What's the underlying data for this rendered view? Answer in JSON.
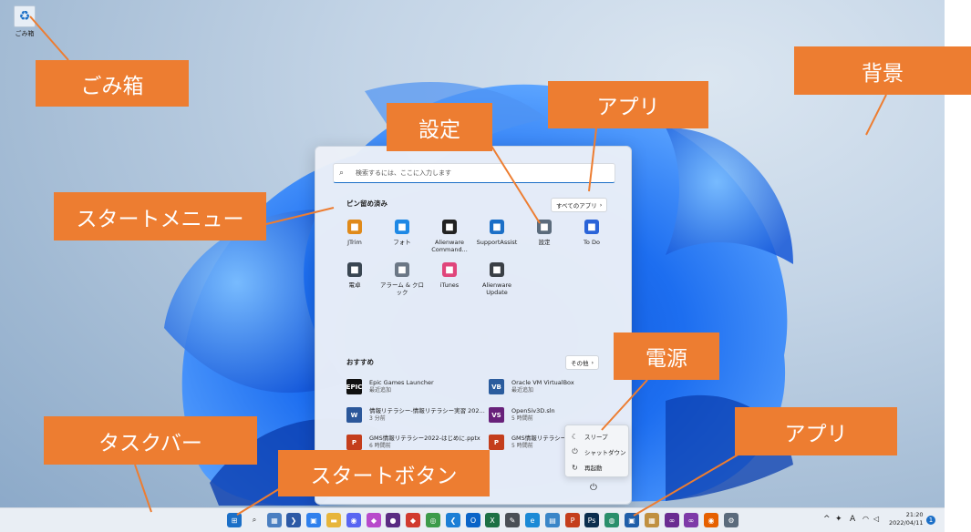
{
  "desktop": {
    "recycle_bin_label": "ごみ箱"
  },
  "callouts": {
    "recycle_bin": "ごみ箱",
    "background": "背景",
    "settings": "設定",
    "apps_top": "アプリ",
    "start_menu": "スタートメニュー",
    "power": "電源",
    "taskbar": "タスクバー",
    "start_button": "スタートボタン",
    "apps_bottom": "アプリ",
    "color": "#ed7d31"
  },
  "start_menu": {
    "search_placeholder": "検索するには、ここに入力します",
    "pinned_title": "ピン留め済み",
    "all_apps_label": "すべてのアプリ",
    "pinned": [
      {
        "label": "JTrim",
        "icon": "jtrim-icon",
        "color": "#e08a1a"
      },
      {
        "label": "フォト",
        "icon": "photos-icon",
        "color": "#1e88e5"
      },
      {
        "label": "Alienware Command...",
        "icon": "alienware-icon",
        "color": "#222222"
      },
      {
        "label": "SupportAssist",
        "icon": "supportassist-icon",
        "color": "#1b6fc7"
      },
      {
        "label": "設定",
        "icon": "gear-icon",
        "color": "#5b6b7c"
      },
      {
        "label": "To Do",
        "icon": "todo-icon",
        "color": "#2a63d8"
      },
      {
        "label": "電卓",
        "icon": "calculator-icon",
        "color": "#3a4652"
      },
      {
        "label": "アラーム & クロック",
        "icon": "clock-icon",
        "color": "#6b7785"
      },
      {
        "label": "iTunes",
        "icon": "itunes-icon",
        "color": "#e0457b"
      },
      {
        "label": "Alienware Update",
        "icon": "alienware-update-icon",
        "color": "#3a3f45"
      }
    ],
    "recommended_title": "おすすめ",
    "more_label": "その他",
    "recommended": [
      {
        "title": "Epic Games Launcher",
        "sub": "最近追加",
        "icon": "EPIC",
        "color": "#111111"
      },
      {
        "title": "Oracle VM VirtualBox",
        "sub": "最近追加",
        "icon": "VB",
        "color": "#2b5c9e"
      },
      {
        "title": "情報リテラシー-情報リテラシー実習 202...",
        "sub": "3 分前",
        "icon": "W",
        "color": "#2b579a"
      },
      {
        "title": "OpenSiv3D.sln",
        "sub": "5 時間前",
        "icon": "VS",
        "color": "#68217a"
      },
      {
        "title": "GMS情報リテラシー2022-はじめに.pptx",
        "sub": "6 時間前",
        "icon": "P",
        "color": "#c43e1c"
      },
      {
        "title": "GMS情報リテラシー...",
        "sub": "5 時間前",
        "icon": "P",
        "color": "#c43e1c"
      }
    ],
    "power_menu": {
      "sleep": "スリープ",
      "shutdown": "シャットダウン",
      "restart": "再起動"
    }
  },
  "taskbar": {
    "icons": [
      {
        "name": "start-button-icon",
        "color": "#1b6fc7",
        "glyph": "⊞"
      },
      {
        "name": "search-icon",
        "color": "#e9eef4",
        "glyph": "⌕"
      },
      {
        "name": "image-viewer-icon",
        "color": "#4a7fc1",
        "glyph": "▦"
      },
      {
        "name": "powershell-icon",
        "color": "#2d5aa6",
        "glyph": "❯"
      },
      {
        "name": "photo-app-icon",
        "color": "#2f80ed",
        "glyph": "▣"
      },
      {
        "name": "explorer-icon",
        "color": "#e7b53b",
        "glyph": "▬"
      },
      {
        "name": "discord-icon",
        "color": "#5865f2",
        "glyph": "◉"
      },
      {
        "name": "app-icon-1",
        "color": "#b84acb",
        "glyph": "◆"
      },
      {
        "name": "github-icon",
        "color": "#5a2c82",
        "glyph": "●"
      },
      {
        "name": "app-icon-2",
        "color": "#d13b2f",
        "glyph": "◆"
      },
      {
        "name": "chrome-icon",
        "color": "#3c9b4a",
        "glyph": "◎"
      },
      {
        "name": "vscode-icon",
        "color": "#1c7fd6",
        "glyph": "❮"
      },
      {
        "name": "outlook-icon",
        "color": "#0a64c8",
        "glyph": "O"
      },
      {
        "name": "excel-icon",
        "color": "#1d7044",
        "glyph": "X"
      },
      {
        "name": "app-icon-3",
        "color": "#4a4f55",
        "glyph": "✎"
      },
      {
        "name": "edge-icon",
        "color": "#1b8ad6",
        "glyph": "e"
      },
      {
        "name": "app-icon-4",
        "color": "#3a86c8",
        "glyph": "▤"
      },
      {
        "name": "powerpoint-icon",
        "color": "#c43e1c",
        "glyph": "P"
      },
      {
        "name": "photoshop-icon",
        "color": "#0b2e4e",
        "glyph": "Ps"
      },
      {
        "name": "globe-icon",
        "color": "#2a8f6b",
        "glyph": "◍"
      },
      {
        "name": "app-icon-5",
        "color": "#1f5ea8",
        "glyph": "▣"
      },
      {
        "name": "app-icon-6",
        "color": "#c09040",
        "glyph": "▦"
      },
      {
        "name": "visual-studio-icon",
        "color": "#6a2c91",
        "glyph": "∞"
      },
      {
        "name": "visual-studio-preview-icon",
        "color": "#7e3aa8",
        "glyph": "∞"
      },
      {
        "name": "firefox-icon",
        "color": "#e66000",
        "glyph": "◉"
      },
      {
        "name": "settings-taskbar-icon",
        "color": "#5b6b7c",
        "glyph": "⚙"
      }
    ],
    "tray": {
      "chevron": "^",
      "ime": "A",
      "time": "21:20",
      "date": "2022/04/11",
      "notification_count": "1"
    }
  }
}
